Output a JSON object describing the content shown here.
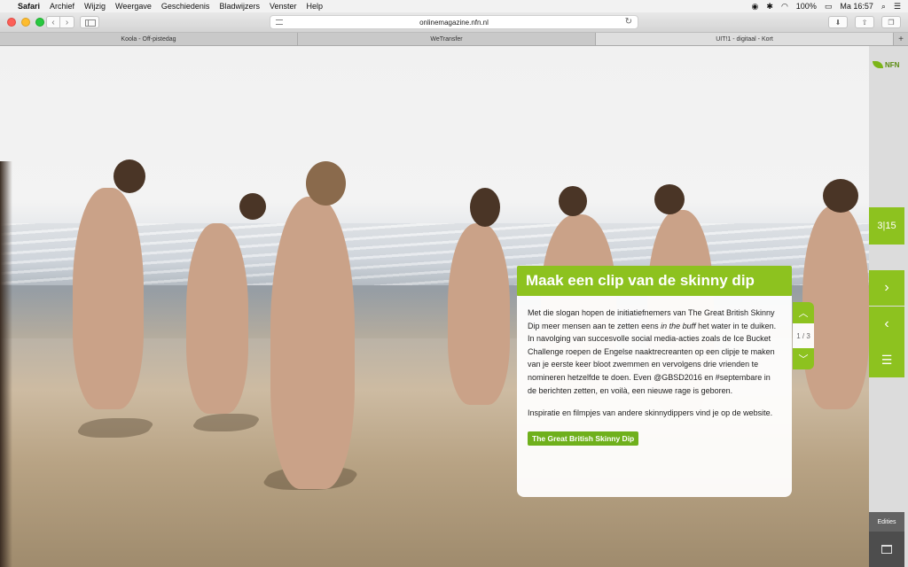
{
  "menubar": {
    "app": "Safari",
    "items": [
      "Archief",
      "Wijzig",
      "Weergave",
      "Geschiedenis",
      "Bladwijzers",
      "Venster",
      "Help"
    ],
    "battery": "100%",
    "clock": "Ma 16:57"
  },
  "browser": {
    "url": "onlinemagazine.nfn.nl",
    "tabs": [
      {
        "label": "Koola - Off-pistedag"
      },
      {
        "label": "WeTransfer"
      },
      {
        "label": "UIT!1 - digitaal - Kort"
      }
    ],
    "add_tab": "+"
  },
  "sidebar": {
    "logo_text": "NFN",
    "counter": "3|15",
    "next_icon": "chevron-right-icon",
    "prev_icon": "chevron-left-icon",
    "menu_icon": "hamburger-icon",
    "edities_label": "Edities"
  },
  "article": {
    "title": "Maak een clip van de skinny dip",
    "para1_before": "Met die slogan hopen de initiatiefnemers van The Great British Skinny Dip meer mensen aan te zetten eens ",
    "para1_em": "in the buff",
    "para1_after": " het water in te duiken. In navolging van succesvolle social media-acties zoals de Ice Bucket Challenge roepen de Engelse naaktrecreanten op een clipje te maken van je eerste keer bloot zwemmen en vervolgens drie vrienden te nomineren hetzelfde te doen. Even @GBSD2016 en #septembare in de berichten zetten, en voilà, een nieuwe rage is geboren.",
    "para2": "Inspiratie en filmpjes van andere skinnydippers vind je op de website.",
    "cta": "The Great British Skinny Dip",
    "pager": "1 / 3"
  },
  "colors": {
    "accent": "#8dc21f",
    "accent_dark": "#6fb01c"
  }
}
